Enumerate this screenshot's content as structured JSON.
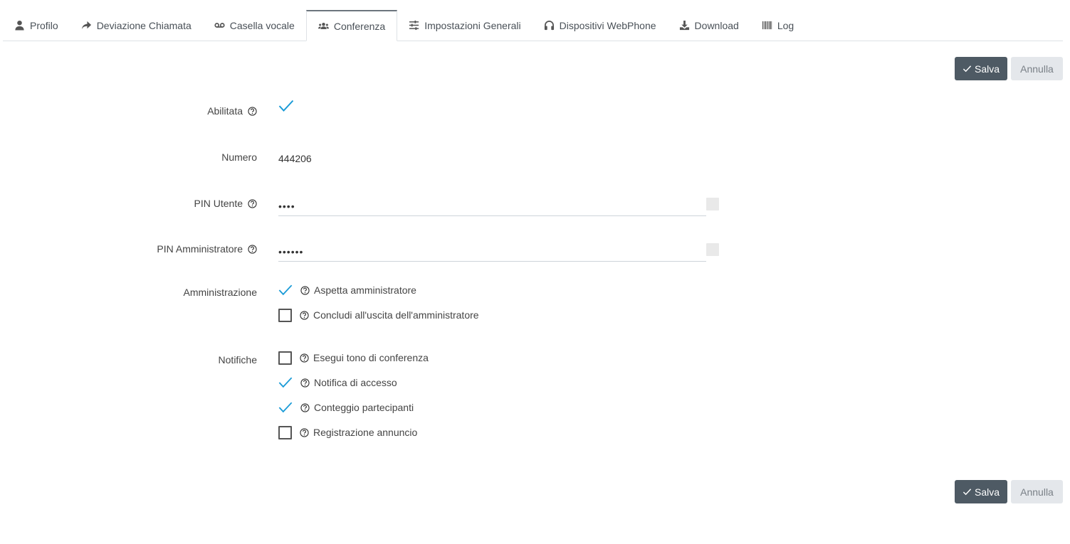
{
  "tabs": [
    {
      "label": "Profilo",
      "icon": "user-icon"
    },
    {
      "label": "Deviazione Chiamata",
      "icon": "share-arrow-icon"
    },
    {
      "label": "Casella vocale",
      "icon": "voicemail-icon"
    },
    {
      "label": "Conferenza",
      "icon": "users-icon",
      "active": true
    },
    {
      "label": "Impostazioni Generali",
      "icon": "sliders-icon"
    },
    {
      "label": "Dispositivi WebPhone",
      "icon": "headphones-icon"
    },
    {
      "label": "Download",
      "icon": "download-icon"
    },
    {
      "label": "Log",
      "icon": "barcode-icon"
    }
  ],
  "actions": {
    "save_label": "Salva",
    "cancel_label": "Annulla"
  },
  "form": {
    "enabled_label": "Abilitata",
    "number_label": "Numero",
    "number_value": "444206",
    "user_pin_label": "PIN Utente",
    "user_pin_value": "••••",
    "admin_pin_label": "PIN Amministratore",
    "admin_pin_value": "••••••",
    "administration_label": "Amministrazione",
    "administration_options": [
      {
        "label": "Aspetta amministratore",
        "checked": true
      },
      {
        "label": "Concludi all'uscita dell'amministratore",
        "checked": false
      }
    ],
    "notifications_label": "Notifiche",
    "notification_options": [
      {
        "label": "Esegui tono di conferenza",
        "checked": false
      },
      {
        "label": "Notifica di accesso",
        "checked": true
      },
      {
        "label": "Conteggio partecipanti",
        "checked": true
      },
      {
        "label": "Registrazione annuncio",
        "checked": false
      }
    ]
  },
  "colors": {
    "accent": "#1a9bd7",
    "save_bg": "#4e5a64",
    "cancel_bg": "#e4e7eb"
  }
}
